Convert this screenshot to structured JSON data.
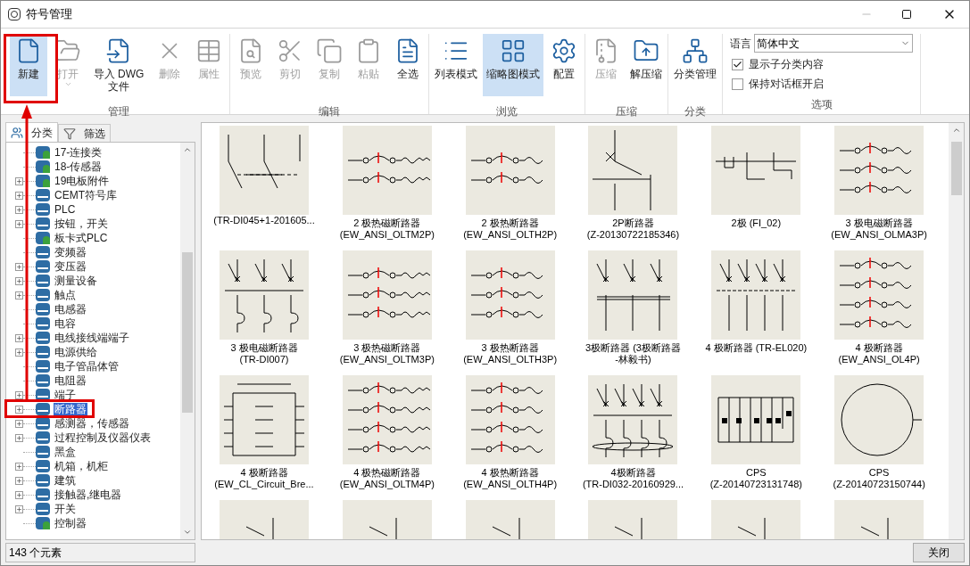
{
  "window": {
    "title": "符号管理"
  },
  "ribbon": {
    "groups": [
      {
        "label": "管理",
        "buttons": [
          {
            "label": "新建",
            "disabled": false,
            "selected": true,
            "dropdown": false
          },
          {
            "label": "打开",
            "disabled": true,
            "selected": false,
            "dropdown": true
          },
          {
            "label": "导入 DWG 文件",
            "disabled": false,
            "selected": false,
            "dropdown": false
          },
          {
            "label": "删除",
            "disabled": true,
            "selected": false,
            "dropdown": false
          },
          {
            "label": "属性",
            "disabled": true,
            "selected": false,
            "dropdown": false
          }
        ]
      },
      {
        "label": "编辑",
        "buttons": [
          {
            "label": "预览",
            "disabled": true,
            "selected": false,
            "dropdown": false
          },
          {
            "label": "剪切",
            "disabled": true,
            "selected": false,
            "dropdown": false
          },
          {
            "label": "复制",
            "disabled": true,
            "selected": false,
            "dropdown": false
          },
          {
            "label": "粘贴",
            "disabled": true,
            "selected": false,
            "dropdown": false
          },
          {
            "label": "全选",
            "disabled": false,
            "selected": false,
            "dropdown": false
          }
        ]
      },
      {
        "label": "浏览",
        "buttons": [
          {
            "label": "列表模式",
            "disabled": false,
            "selected": false,
            "dropdown": false
          },
          {
            "label": "缩略图模式",
            "disabled": false,
            "selected": true,
            "dropdown": false
          },
          {
            "label": "配置",
            "disabled": false,
            "selected": false,
            "dropdown": false
          }
        ]
      },
      {
        "label": "压缩",
        "buttons": [
          {
            "label": "压缩",
            "disabled": true,
            "selected": false,
            "dropdown": false
          },
          {
            "label": "解压缩",
            "disabled": false,
            "selected": false,
            "dropdown": false
          }
        ]
      },
      {
        "label": "分类",
        "buttons": [
          {
            "label": "分类管理",
            "disabled": false,
            "selected": false,
            "dropdown": false
          }
        ]
      }
    ],
    "options": {
      "label": "选项",
      "language_label": "语言",
      "language": "简体中文",
      "checkboxes": [
        {
          "label": "显示子分类内容",
          "checked": true
        },
        {
          "label": "保持对话框开启",
          "checked": false
        }
      ]
    }
  },
  "sidebar": {
    "tabs": [
      {
        "label": "分类",
        "selected": true
      },
      {
        "label": "筛选",
        "selected": false
      }
    ],
    "items": [
      {
        "label": "17-连接类",
        "expandable": false,
        "kind": "user",
        "selected": false
      },
      {
        "label": "18-传感器",
        "expandable": false,
        "kind": "user",
        "selected": false
      },
      {
        "label": "19电板附件",
        "expandable": true,
        "kind": "user",
        "selected": false
      },
      {
        "label": "CEMT符号库",
        "expandable": true,
        "kind": "library",
        "selected": false
      },
      {
        "label": "PLC",
        "expandable": true,
        "kind": "library",
        "selected": false
      },
      {
        "label": "按钮，开关",
        "expandable": true,
        "kind": "library",
        "selected": false
      },
      {
        "label": "板卡式PLC",
        "expandable": false,
        "kind": "user",
        "selected": false
      },
      {
        "label": "变频器",
        "expandable": false,
        "kind": "library",
        "selected": false
      },
      {
        "label": "变压器",
        "expandable": true,
        "kind": "library",
        "selected": false
      },
      {
        "label": "测量设备",
        "expandable": true,
        "kind": "library",
        "selected": false
      },
      {
        "label": "触点",
        "expandable": true,
        "kind": "library",
        "selected": false
      },
      {
        "label": "电感器",
        "expandable": false,
        "kind": "library",
        "selected": false
      },
      {
        "label": "电容",
        "expandable": false,
        "kind": "library",
        "selected": false
      },
      {
        "label": "电线接线端端子",
        "expandable": true,
        "kind": "library",
        "selected": false
      },
      {
        "label": "电源供给",
        "expandable": true,
        "kind": "library",
        "selected": false
      },
      {
        "label": "电子管晶体管",
        "expandable": false,
        "kind": "library",
        "selected": false
      },
      {
        "label": "电阻器",
        "expandable": false,
        "kind": "library",
        "selected": false
      },
      {
        "label": "端子",
        "expandable": true,
        "kind": "library",
        "selected": false
      },
      {
        "label": "断路器",
        "expandable": true,
        "kind": "library",
        "selected": true
      },
      {
        "label": "感测器，传感器",
        "expandable": true,
        "kind": "library",
        "selected": false
      },
      {
        "label": "过程控制及仪器仪表",
        "expandable": true,
        "kind": "library",
        "selected": false
      },
      {
        "label": "黑盒",
        "expandable": false,
        "kind": "library",
        "selected": false
      },
      {
        "label": "机箱，机柜",
        "expandable": true,
        "kind": "library",
        "selected": false
      },
      {
        "label": "建筑",
        "expandable": true,
        "kind": "library",
        "selected": false
      },
      {
        "label": "接触器,继电器",
        "expandable": true,
        "kind": "library",
        "selected": false
      },
      {
        "label": "开关",
        "expandable": true,
        "kind": "library",
        "selected": false
      },
      {
        "label": "控制器",
        "expandable": false,
        "kind": "user",
        "selected": false
      }
    ]
  },
  "thumbnails": [
    {
      "code": "(TR-DI045+1-201605...",
      "kind": "switch-dashed"
    },
    {
      "name": "2 极热磁断路器",
      "code": "(EW_ANSI_OLTM2P)",
      "kind": "thermal-magnetic-2"
    },
    {
      "name": "2 极热断路器",
      "code": "(EW_ANSI_OLTH2P)",
      "kind": "thermal-2"
    },
    {
      "name": "2P断路器",
      "code": "(Z-20130722185346)",
      "kind": "crossed-2"
    },
    {
      "name": "2极 (FI_02)",
      "kind": "control"
    },
    {
      "name": "3 极电磁断路器",
      "code": "(EW_ANSI_OLMA3P)",
      "kind": "magnetic-3"
    },
    {
      "name": "3 极电磁断路器",
      "code": "(TR-DI007)",
      "kind": "poles-3"
    },
    {
      "name": "3 极热磁断路器",
      "code": "(EW_ANSI_OLTM3P)",
      "kind": "thermal-magnetic-3"
    },
    {
      "name": "3 极热断路器",
      "code": "(EW_ANSI_OLTH3P)",
      "kind": "thermal-3"
    },
    {
      "name": "3极断路器 (3极断路器",
      "code": "-林毅书)",
      "kind": "linked-3"
    },
    {
      "name": "4 极断路器 (TR-EL020)",
      "kind": "poles-4"
    },
    {
      "name": "4 极断路器",
      "code": "(EW_ANSI_OL4P)",
      "kind": "magnetic-4"
    },
    {
      "name": "4 极断路器",
      "code": "(EW_CL_Circuit_Bre...",
      "kind": "box-4"
    },
    {
      "name": "4 极热磁断路器",
      "code": "(EW_ANSI_OLTM4P)",
      "kind": "thermal-magnetic-4"
    },
    {
      "name": "4 极热断路器",
      "code": "(EW_ANSI_OLTH4P)",
      "kind": "thermal-4"
    },
    {
      "name": "4极断路器",
      "code": "(TR-DI032-20160929...",
      "kind": "coil-4"
    },
    {
      "name": "CPS",
      "code": "(Z-20140723131748)",
      "kind": "strip"
    },
    {
      "name": "CPS",
      "code": "(Z-20140723150744)",
      "kind": "circle"
    },
    {
      "kind": "partial"
    },
    {
      "kind": "partial"
    },
    {
      "kind": "partial"
    },
    {
      "kind": "partial"
    },
    {
      "kind": "partial"
    },
    {
      "kind": "partial"
    }
  ],
  "status_bar": {
    "count": "143 个元素",
    "close_button": "关闭"
  }
}
